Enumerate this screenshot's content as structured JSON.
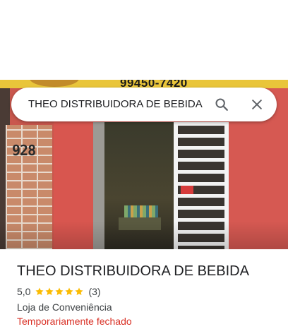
{
  "search": {
    "query": "THEO DISTRIBUIDORA DE BEBIDA",
    "search_icon": "search-icon",
    "close_icon": "close-icon"
  },
  "photo": {
    "banner_phone": "99450-7420",
    "house_number": "928"
  },
  "place": {
    "name": "THEO DISTRIBUIDORA DE BEBIDA",
    "rating": "5,0",
    "stars": 5,
    "review_count": "(3)",
    "category": "Loja de Conveniência",
    "status": "Temporariamente fechado"
  },
  "colors": {
    "star": "#fbbc04",
    "status_closed": "#d93025",
    "icon": "#5f6368",
    "text_primary": "#202124",
    "text_secondary": "#3c4043"
  }
}
